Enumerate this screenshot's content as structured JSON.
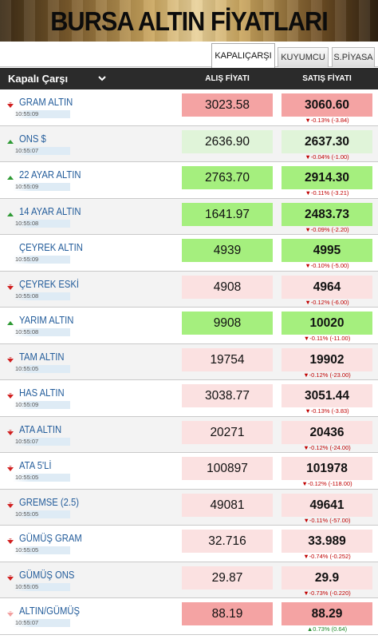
{
  "banner": {
    "title": "BURSA ALTIN FİYATLARI"
  },
  "tabs": [
    {
      "label": "KAPALIÇARŞI",
      "active": true
    },
    {
      "label": "KUYUMCU",
      "active": false
    },
    {
      "label": "S.PİYASA",
      "active": false
    }
  ],
  "header": {
    "market": "Kapalı Çarşı",
    "buy": "ALIŞ FİYATI",
    "sell": "SATIŞ FİYATI"
  },
  "colors": {
    "red_strong": "#f4a3a3",
    "red_light": "#fbe1e1",
    "green_strong": "#a5ef7e",
    "green_light": "#e0f4d9",
    "arrow_down": "#d11f1f",
    "arrow_up": "#2e9a34"
  },
  "rows": [
    {
      "name": "GRAM ALTIN",
      "time": "10:55:09",
      "buy": "3023.58",
      "sell": "3060.60",
      "change": "▼-0.13% (-3.84)",
      "dir": "down",
      "arrow": "down",
      "buy_tone": "red_strong",
      "sell_tone": "red_strong"
    },
    {
      "name": "ONS $",
      "time": "10:55:07",
      "buy": "2636.90",
      "sell": "2637.30",
      "change": "▼-0.04% (-1.00)",
      "dir": "down",
      "arrow": "up",
      "buy_tone": "green_light",
      "sell_tone": "green_light"
    },
    {
      "name": "22 AYAR ALTIN",
      "time": "10:55:09",
      "buy": "2763.70",
      "sell": "2914.30",
      "change": "▼-0.11% (-3.21)",
      "dir": "down",
      "arrow": "up",
      "buy_tone": "green_strong",
      "sell_tone": "green_strong"
    },
    {
      "name": "14 AYAR ALTIN",
      "time": "10:55:08",
      "buy": "1641.97",
      "sell": "2483.73",
      "change": "▼-0.09% (-2.20)",
      "dir": "down",
      "arrow": "up",
      "buy_tone": "green_strong",
      "sell_tone": "green_strong"
    },
    {
      "name": "ÇEYREK ALTIN",
      "time": "10:55:09",
      "buy": "4939",
      "sell": "4995",
      "change": "▼-0.10% (-5.00)",
      "dir": "down",
      "arrow": "none",
      "buy_tone": "green_strong",
      "sell_tone": "green_strong"
    },
    {
      "name": "ÇEYREK ESKİ",
      "time": "10:55:08",
      "buy": "4908",
      "sell": "4964",
      "change": "▼-0.12% (-6.00)",
      "dir": "down",
      "arrow": "down",
      "buy_tone": "red_light",
      "sell_tone": "red_light"
    },
    {
      "name": "YARIM ALTIN",
      "time": "10:55:08",
      "buy": "9908",
      "sell": "10020",
      "change": "▼-0.11% (-11.00)",
      "dir": "down",
      "arrow": "up",
      "buy_tone": "green_strong",
      "sell_tone": "green_strong"
    },
    {
      "name": "TAM ALTIN",
      "time": "10:55:05",
      "buy": "19754",
      "sell": "19902",
      "change": "▼-0.12% (-23.00)",
      "dir": "down",
      "arrow": "down",
      "buy_tone": "red_light",
      "sell_tone": "red_light"
    },
    {
      "name": "HAS ALTIN",
      "time": "10:55:09",
      "buy": "3038.77",
      "sell": "3051.44",
      "change": "▼-0.13% (-3.83)",
      "dir": "down",
      "arrow": "down",
      "buy_tone": "red_light",
      "sell_tone": "red_light"
    },
    {
      "name": "ATA ALTIN",
      "time": "10:55:07",
      "buy": "20271",
      "sell": "20436",
      "change": "▼-0.12% (-24.00)",
      "dir": "down",
      "arrow": "down",
      "buy_tone": "red_light",
      "sell_tone": "red_light"
    },
    {
      "name": "ATA 5'Lİ",
      "time": "10:55:05",
      "buy": "100897",
      "sell": "101978",
      "change": "▼-0.12% (-118.00)",
      "dir": "down",
      "arrow": "down",
      "buy_tone": "red_light",
      "sell_tone": "red_light"
    },
    {
      "name": "GREMSE (2.5)",
      "time": "10:55:05",
      "buy": "49081",
      "sell": "49641",
      "change": "▼-0.11% (-57.00)",
      "dir": "down",
      "arrow": "down",
      "buy_tone": "red_light",
      "sell_tone": "red_light"
    },
    {
      "name": "GÜMÜŞ GRAM",
      "time": "10:55:05",
      "buy": "32.716",
      "sell": "33.989",
      "change": "▼-0.74% (-0.252)",
      "dir": "down",
      "arrow": "down",
      "buy_tone": "red_light",
      "sell_tone": "red_light"
    },
    {
      "name": "GÜMÜŞ ONS",
      "time": "10:55:05",
      "buy": "29.87",
      "sell": "29.9",
      "change": "▼-0.73% (-0.220)",
      "dir": "down",
      "arrow": "down",
      "buy_tone": "red_light",
      "sell_tone": "red_light"
    },
    {
      "name": "ALTIN/GÜMÜŞ",
      "time": "10:55:07",
      "buy": "88.19",
      "sell": "88.29",
      "change": "▲0.73% (0.64)",
      "dir": "up",
      "arrow": "down_light",
      "buy_tone": "red_strong",
      "sell_tone": "red_strong"
    }
  ]
}
